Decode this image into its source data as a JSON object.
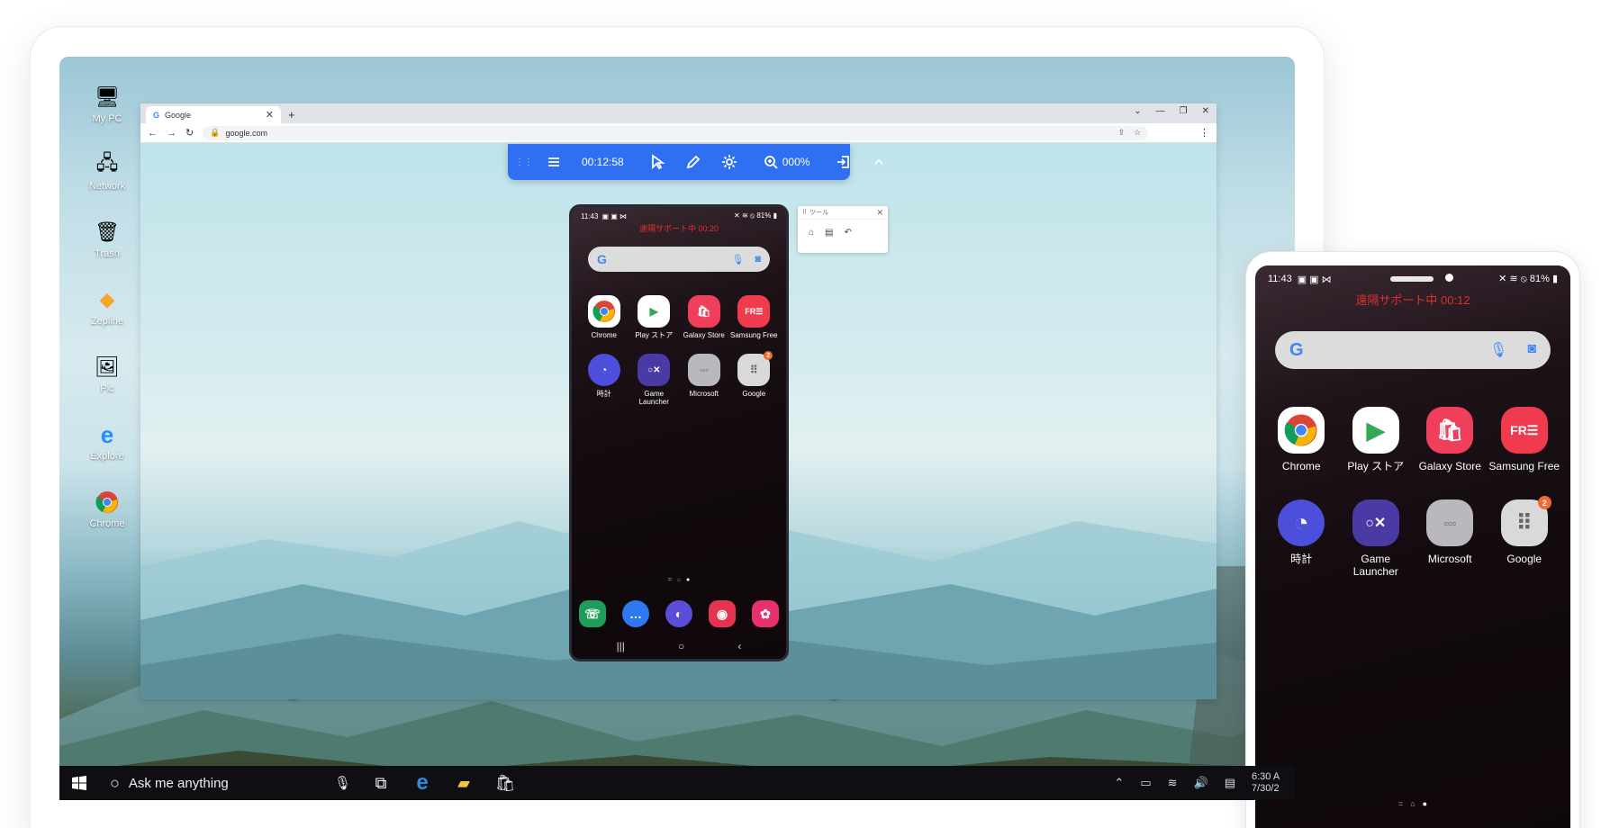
{
  "desktop": {
    "icons": [
      {
        "label": "My PC",
        "icon": "computer-icon"
      },
      {
        "label": "Network",
        "icon": "network-icon"
      },
      {
        "label": "Trash",
        "icon": "trash-icon"
      },
      {
        "label": "Zepline",
        "icon": "zeplin-icon"
      },
      {
        "label": "Pic",
        "icon": "picture-icon"
      },
      {
        "label": "Explore",
        "icon": "internet-explorer-icon"
      },
      {
        "label": "Chrome",
        "icon": "chrome-icon"
      }
    ]
  },
  "browser": {
    "tab_title": "Google",
    "new_tab": "+",
    "url": "google.com"
  },
  "toolbar": {
    "timer": "00:12:58",
    "zoom": "000%"
  },
  "tool_window": {
    "title": "ツール"
  },
  "phone_small": {
    "time": "11:43",
    "battery": "81%",
    "remote_status": "遠隔サポート中  00:20"
  },
  "phone_big": {
    "time": "11:43",
    "battery": "81%",
    "remote_status": "遠隔サポート中  00:12"
  },
  "apps": [
    {
      "label": "Chrome",
      "glyph": "",
      "bg": "#ffffff"
    },
    {
      "label": "Play ストア",
      "glyph": "▶",
      "bg": "#ffffff"
    },
    {
      "label": "Galaxy Store",
      "glyph": "🛍",
      "bg": "#ef3f5a"
    },
    {
      "label": "Samsung Free",
      "glyph": "FR☰",
      "bg": "#f03a4e"
    },
    {
      "label": "時計",
      "glyph": "◔",
      "bg": "#4b4fd9"
    },
    {
      "label": "Game Launcher",
      "glyph": "○✕",
      "bg": "#4a3aa6"
    },
    {
      "label": "Microsoft",
      "glyph": "▫▫▫",
      "bg": "#b9b9bd"
    },
    {
      "label": "Google",
      "glyph": "⠿",
      "bg": "#d9d9d9",
      "badge": "2"
    }
  ],
  "dock": [
    {
      "icon": "phone-icon",
      "glyph": "☏",
      "bg": "#1f9e5b"
    },
    {
      "icon": "messages-icon",
      "glyph": "…",
      "bg": "#2e79f0"
    },
    {
      "icon": "internet-icon",
      "glyph": "◐",
      "bg": "#5b4ed6"
    },
    {
      "icon": "camera-icon",
      "glyph": "◉",
      "bg": "#e6334f"
    },
    {
      "icon": "gallery-icon",
      "glyph": "✿",
      "bg": "#e7306d"
    }
  ],
  "taskbar": {
    "search_placeholder": "Ask me anything",
    "time": "6:30 A",
    "date": "7/30/2"
  },
  "colors": {
    "toolbar_blue": "#2f6ff2",
    "remote_red": "#e0302b"
  }
}
